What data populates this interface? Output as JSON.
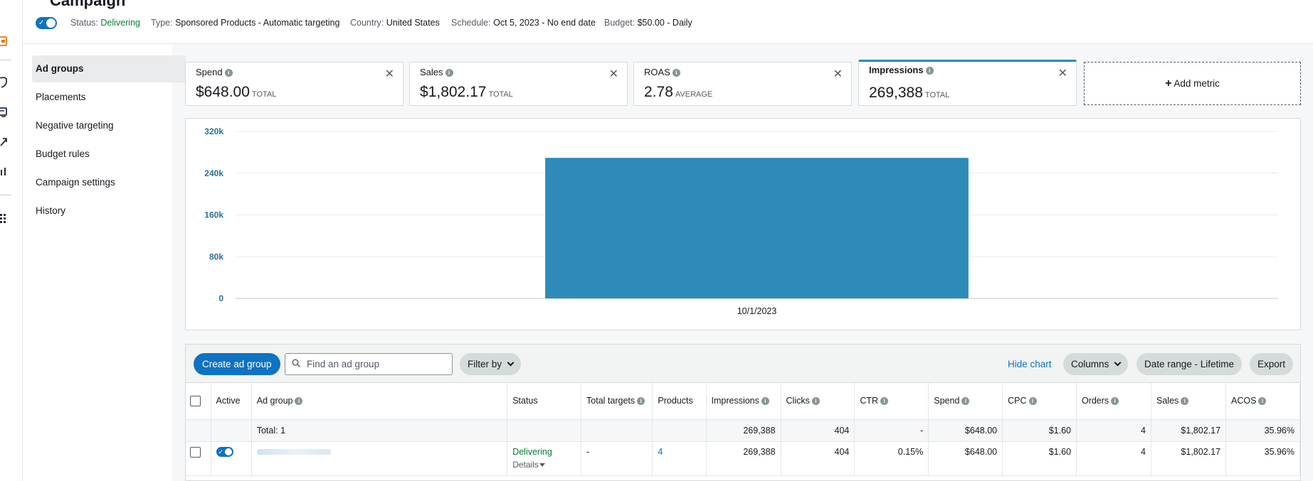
{
  "page": {
    "title": "Campaign"
  },
  "campaign": {
    "status_label": "Status:",
    "status_value": "Delivering",
    "type_label": "Type:",
    "type_value": "Sponsored Products - Automatic targeting",
    "country_label": "Country:",
    "country_value": "United States",
    "schedule_label": "Schedule:",
    "schedule_value": "Oct 5, 2023 - No end date",
    "budget_label": "Budget:",
    "budget_value": "$50.00 - Daily",
    "enabled": true
  },
  "sidebar": {
    "items": [
      {
        "label": "Ad groups",
        "active": true
      },
      {
        "label": "Placements"
      },
      {
        "label": "Negative targeting"
      },
      {
        "label": "Budget rules"
      },
      {
        "label": "Campaign settings"
      },
      {
        "label": "History"
      }
    ]
  },
  "metrics": [
    {
      "label": "Spend",
      "value": "$648.00",
      "unit": "TOTAL"
    },
    {
      "label": "Sales",
      "value": "$1,802.17",
      "unit": "TOTAL"
    },
    {
      "label": "ROAS",
      "value": "2.78",
      "unit": "AVERAGE"
    },
    {
      "label": "Impressions",
      "value": "269,388",
      "unit": "TOTAL",
      "selected": true
    }
  ],
  "add_metric": {
    "label": "Add metric"
  },
  "chart_data": {
    "type": "bar",
    "categories": [
      "10/1/2023"
    ],
    "series": [
      {
        "values": [
          269388
        ]
      }
    ],
    "ylim": [
      0,
      320000
    ],
    "yticks": [
      0,
      80000,
      160000,
      240000,
      320000
    ],
    "ytick_labels": [
      "0",
      "80k",
      "160k",
      "240k",
      "320k"
    ],
    "grid": true,
    "bar_color": "#2e8bb9"
  },
  "toolbar": {
    "create_label": "Create ad group",
    "search_placeholder": "Find an ad group",
    "filter_label": "Filter by",
    "hide_chart_label": "Hide chart",
    "columns_label": "Columns",
    "date_range_label": "Date range - Lifetime",
    "export_label": "Export"
  },
  "table": {
    "headers": {
      "active": "Active",
      "ad_group": "Ad group",
      "status": "Status",
      "total_targets": "Total targets",
      "products": "Products",
      "impressions": "Impressions",
      "clicks": "Clicks",
      "ctr": "CTR",
      "spend": "Spend",
      "cpc": "CPC",
      "orders": "Orders",
      "sales": "Sales",
      "acos": "ACOS"
    },
    "total": {
      "label": "Total: 1",
      "impressions": "269,388",
      "clicks": "404",
      "ctr": "-",
      "spend": "$648.00",
      "cpc": "$1.60",
      "orders": "4",
      "sales": "$1,802.17",
      "acos": "35.96%"
    },
    "row": {
      "status": "Delivering",
      "details": "Details",
      "total_targets": "-",
      "products": "4",
      "impressions": "269,388",
      "clicks": "404",
      "ctr": "0.15%",
      "spend": "$648.00",
      "cpc": "$1.60",
      "orders": "4",
      "sales": "$1,802.17",
      "acos": "35.96%"
    }
  },
  "colors": {
    "accent": "#0e73c3",
    "delivering": "#067d36",
    "bar": "#2e8bb9"
  }
}
